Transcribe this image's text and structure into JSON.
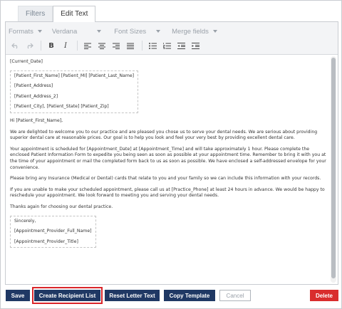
{
  "tabs": [
    {
      "label": "Filters",
      "active": false
    },
    {
      "label": "Edit Text",
      "active": true
    }
  ],
  "toolbar": {
    "formats": "Formats",
    "font": "Verdana",
    "font_sizes": "Font Sizes",
    "merge_fields": "Merge fields",
    "bold": "B",
    "italic": "I"
  },
  "document": {
    "current_date": "[Current_Date]",
    "address_block": [
      "[Patient_First_Name] [Patient_MI] [Patient_Last_Name]",
      "[Patient_Address]",
      "[Patient_Address_2]",
      "[Patient_City], [Patient_State] [Patient_Zip]"
    ],
    "greeting": "Hi [Patient_First_Name],",
    "paragraphs": [
      "We are delighted to welcome you to our practice and are pleased you chose us to serve your dental needs. We are serious about providing superior dental care at reasonable prices. Our goal is to help you look and feel your very best by providing excellent dental care.",
      "Your appointment is scheduled for [Appointment_Date] at [Appointment_Time] and will take approximately 1 hour. Please complete the enclosed Patient Information Form to expedite you being seen as soon as possible at your appointment time. Remember to bring it with you at the time of your appointment or mail the completed form back to us as soon as possible. We have enclosed a self-addressed envelope for your convenience.",
      "Please bring any Insurance (Medical or Dental) cards that relate to you and your family so we can include this information with your records.",
      "If you are unable to make your scheduled appointment, please call us at [Practice_Phone] at least 24 hours in advance. We would be happy to reschedule your appointment. We look forward to meeting you and serving your dental needs.",
      "Thanks again for choosing our dental practice."
    ],
    "signature_block": [
      "Sincerely,",
      "[Appointment_Provider_Full_Name]",
      "[Appointment_Provider_Title]"
    ]
  },
  "buttons": {
    "save": "Save",
    "create_recipient_list": "Create Recipient List",
    "reset_letter_text": "Reset Letter Text",
    "copy_template": "Copy Template",
    "cancel": "Cancel",
    "delete": "Delete"
  },
  "colors": {
    "primary": "#1f3864",
    "danger": "#d92d2d",
    "highlight": "#d9252a"
  }
}
